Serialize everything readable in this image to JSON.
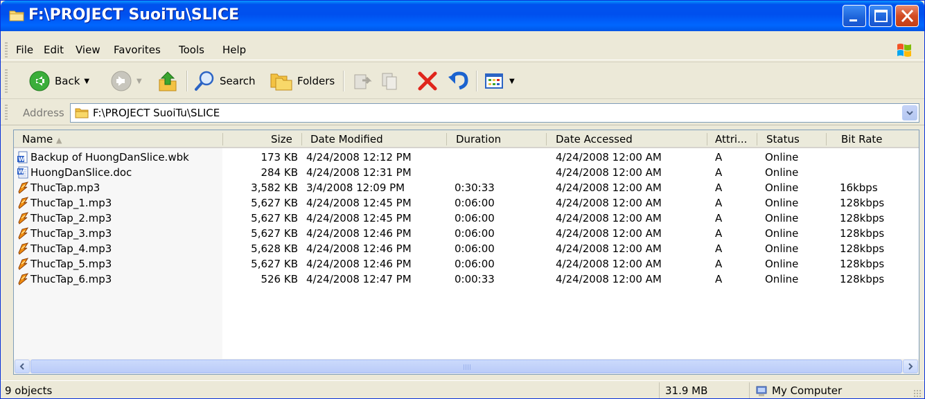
{
  "window": {
    "title": "F:\\PROJECT SuoiTu\\SLICE",
    "colors": {
      "titlebar": "#0054E3",
      "close": "#C33F17",
      "face": "#ECE9D8"
    }
  },
  "menu": {
    "items": [
      {
        "label": "File"
      },
      {
        "label": "Edit"
      },
      {
        "label": "View"
      },
      {
        "label": "Favorites"
      },
      {
        "label": "Tools"
      },
      {
        "label": "Help"
      }
    ]
  },
  "toolbar": {
    "back_label": "Back",
    "search_label": "Search",
    "folders_label": "Folders",
    "icons": [
      "back-arrow-icon",
      "forward-arrow-icon",
      "up-folder-icon",
      "search-icon",
      "folders-icon",
      "move-to-icon",
      "copy-to-icon",
      "delete-icon",
      "undo-icon",
      "views-icon"
    ]
  },
  "address": {
    "label": "Address",
    "value": "F:\\PROJECT SuoiTu\\SLICE"
  },
  "columns": {
    "name": "Name",
    "size": "Size",
    "date_modified": "Date Modified",
    "duration": "Duration",
    "date_accessed": "Date Accessed",
    "attributes": "Attri...",
    "status": "Status",
    "bit_rate": "Bit Rate"
  },
  "files": [
    {
      "icon": "word-backup-icon",
      "name": "Backup of HuongDanSlice.wbk",
      "size": "173 KB",
      "modified": "4/24/2008 12:12 PM",
      "duration": "",
      "accessed": "4/24/2008 12:00 AM",
      "attr": "A",
      "status": "Online",
      "bitrate": ""
    },
    {
      "icon": "word-document-icon",
      "name": "HuongDanSlice.doc",
      "size": "284 KB",
      "modified": "4/24/2008 12:31 PM",
      "duration": "",
      "accessed": "4/24/2008 12:00 AM",
      "attr": "A",
      "status": "Online",
      "bitrate": ""
    },
    {
      "icon": "mp3-audio-icon",
      "name": "ThucTap.mp3",
      "size": "3,582 KB",
      "modified": "3/4/2008 12:09 PM",
      "duration": "0:30:33",
      "accessed": "4/24/2008 12:00 AM",
      "attr": "A",
      "status": "Online",
      "bitrate": "16kbps"
    },
    {
      "icon": "mp3-audio-icon",
      "name": "ThucTap_1.mp3",
      "size": "5,627 KB",
      "modified": "4/24/2008 12:45 PM",
      "duration": "0:06:00",
      "accessed": "4/24/2008 12:00 AM",
      "attr": "A",
      "status": "Online",
      "bitrate": "128kbps"
    },
    {
      "icon": "mp3-audio-icon",
      "name": "ThucTap_2.mp3",
      "size": "5,627 KB",
      "modified": "4/24/2008 12:45 PM",
      "duration": "0:06:00",
      "accessed": "4/24/2008 12:00 AM",
      "attr": "A",
      "status": "Online",
      "bitrate": "128kbps"
    },
    {
      "icon": "mp3-audio-icon",
      "name": "ThucTap_3.mp3",
      "size": "5,627 KB",
      "modified": "4/24/2008 12:46 PM",
      "duration": "0:06:00",
      "accessed": "4/24/2008 12:00 AM",
      "attr": "A",
      "status": "Online",
      "bitrate": "128kbps"
    },
    {
      "icon": "mp3-audio-icon",
      "name": "ThucTap_4.mp3",
      "size": "5,628 KB",
      "modified": "4/24/2008 12:46 PM",
      "duration": "0:06:00",
      "accessed": "4/24/2008 12:00 AM",
      "attr": "A",
      "status": "Online",
      "bitrate": "128kbps"
    },
    {
      "icon": "mp3-audio-icon",
      "name": "ThucTap_5.mp3",
      "size": "5,627 KB",
      "modified": "4/24/2008 12:46 PM",
      "duration": "0:06:00",
      "accessed": "4/24/2008 12:00 AM",
      "attr": "A",
      "status": "Online",
      "bitrate": "128kbps"
    },
    {
      "icon": "mp3-audio-icon",
      "name": "ThucTap_6.mp3",
      "size": "526 KB",
      "modified": "4/24/2008 12:47 PM",
      "duration": "0:00:33",
      "accessed": "4/24/2008 12:00 AM",
      "attr": "A",
      "status": "Online",
      "bitrate": "128kbps"
    }
  ],
  "status": {
    "objects": "9 objects",
    "size": "31.9 MB",
    "location": "My Computer"
  }
}
